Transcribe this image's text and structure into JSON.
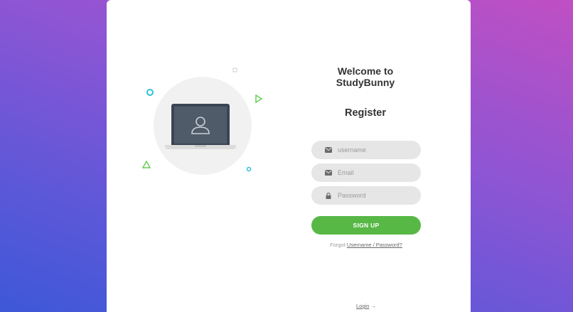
{
  "colors": {
    "accent": "#57b846",
    "gradient_start": "#c04fc3",
    "gradient_end": "#3d58d8"
  },
  "header": {
    "welcome_line1": "Welcome to",
    "welcome_line2": "StudyBunny",
    "register": "Register"
  },
  "form": {
    "username": {
      "placeholder": "username",
      "icon": "envelope-icon"
    },
    "email": {
      "placeholder": "Email",
      "icon": "envelope-icon"
    },
    "password": {
      "placeholder": "Password",
      "icon": "lock-icon"
    },
    "submit_label": "SIGN UP"
  },
  "links": {
    "forgot_prefix": "Forgot",
    "forgot_link": "Username / Password?",
    "login": "Login",
    "login_arrow": "→"
  }
}
